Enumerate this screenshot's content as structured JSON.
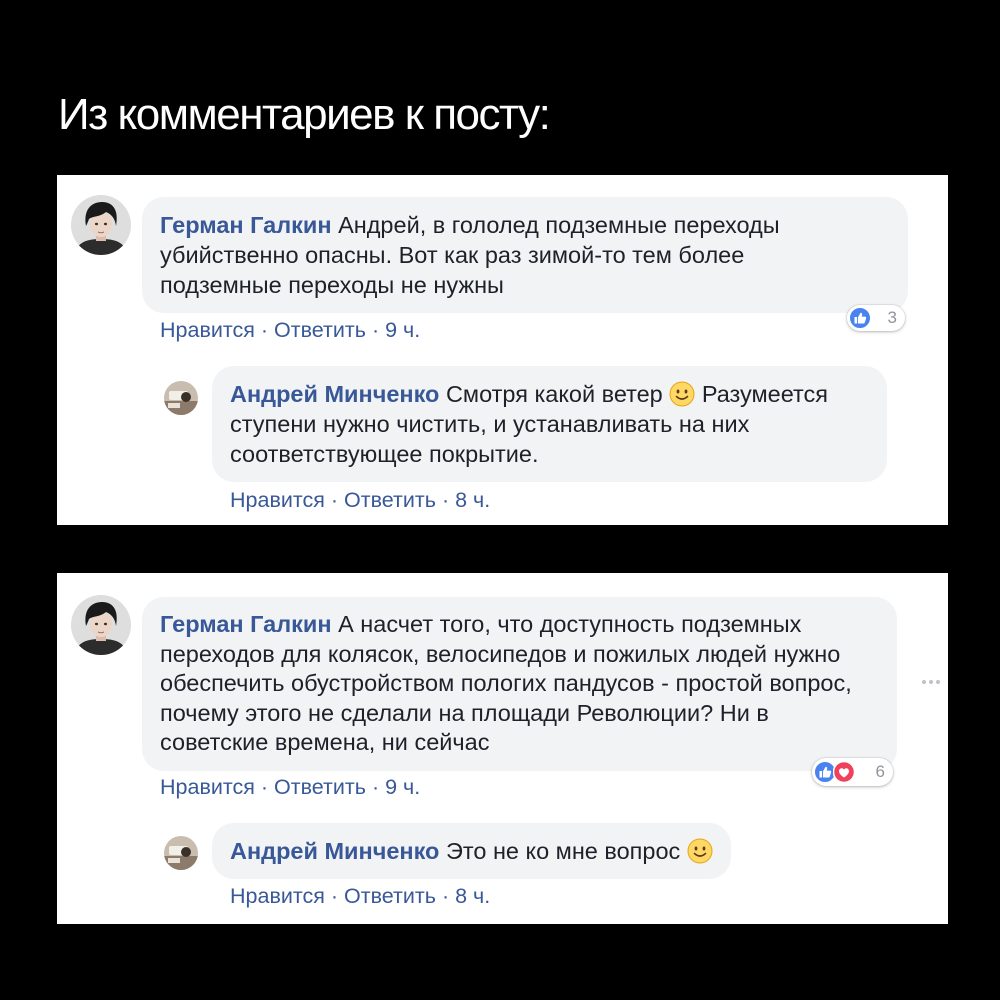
{
  "title": "Из комментариев к посту:",
  "colors": {
    "background": "#000000",
    "panel": "#ffffff",
    "bubble": "#f2f3f5",
    "author": "#385898",
    "body_text": "#1d2129",
    "action": "#385898",
    "like": "#4a83f0",
    "love": "#f0405b",
    "count": "#90949c"
  },
  "separator": "·",
  "threads": [
    {
      "comment": {
        "avatar_icon": "avatar-photo-icon",
        "author": "Герман Галкин",
        "text": "Андрей, в гололед подземные переходы\nубийственно опасны. Вот как раз зимой-то тем более\nподземные переходы не нужны",
        "actions": {
          "like": "Нравится",
          "reply": "Ответить",
          "time": "9 ч."
        },
        "reactions": {
          "icons": [
            "like-icon"
          ],
          "count": "3"
        }
      },
      "reply": {
        "avatar_icon": "avatar-photo-icon",
        "author": "Андрей Минченко",
        "text_before": "Смотря какой ветер",
        "emoji": "slightly-smiling-face-icon",
        "text_after": "Разумеется\nступени нужно чистить, и устанавливать на них\nсоответствующее покрытие.",
        "actions": {
          "like": "Нравится",
          "reply": "Ответить",
          "time": "8 ч."
        }
      }
    },
    {
      "comment": {
        "avatar_icon": "avatar-photo-icon",
        "author": "Герман Галкин",
        "text": "А насчет того, что доступность подземных\nпереходов для колясок, велосипедов и пожилых людей нужно\nобеспечить обустройством пологих пандусов - простой вопрос,\nпочему этого не сделали на площади Революции? Ни в\nсоветские времена, ни сейчас",
        "actions": {
          "like": "Нравится",
          "reply": "Ответить",
          "time": "9 ч."
        },
        "reactions": {
          "icons": [
            "like-icon",
            "love-icon"
          ],
          "count": "6"
        },
        "more_icon": "more-options-icon"
      },
      "reply": {
        "avatar_icon": "avatar-photo-icon",
        "author": "Андрей Минченко",
        "text_before": "Это не ко мне вопрос",
        "emoji": "slightly-smiling-face-icon",
        "actions": {
          "like": "Нравится",
          "reply": "Ответить",
          "time": "8 ч."
        }
      }
    }
  ]
}
